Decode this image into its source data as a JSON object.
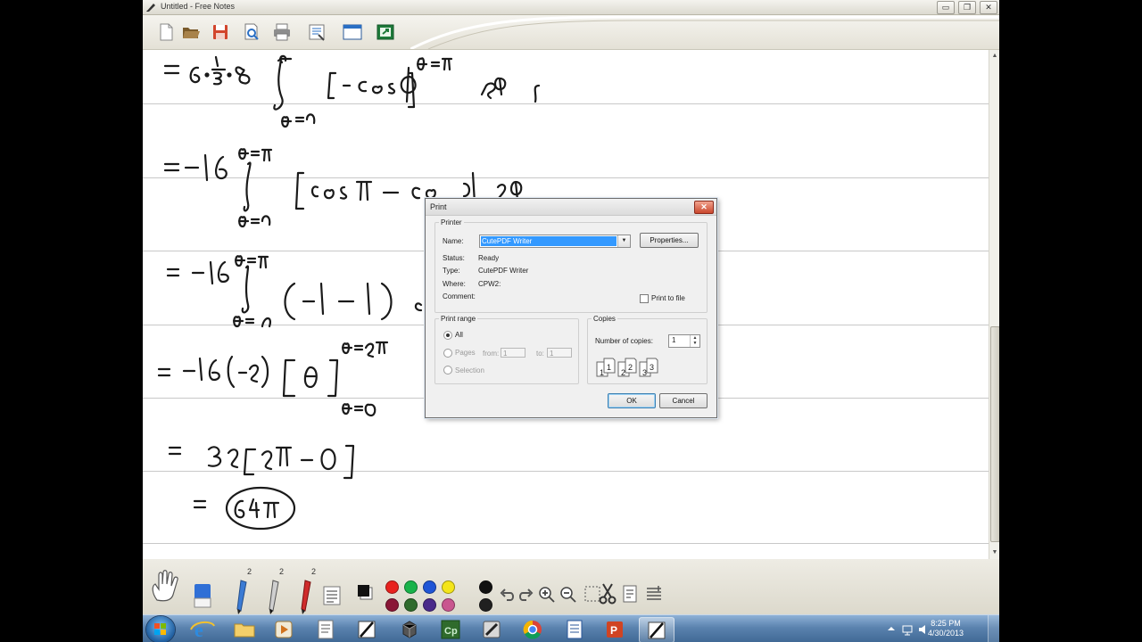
{
  "window": {
    "title": "Untitled - Free Notes",
    "controls": {
      "minimize": "▭",
      "maximize": "❐",
      "close": "✕"
    }
  },
  "toolbar": {
    "icons": [
      "new-page-icon",
      "open-folder-icon",
      "save-icon",
      "print-preview-icon",
      "print-icon",
      "page-setup-icon",
      "fullscreen-icon",
      "export-icon"
    ]
  },
  "notes": {
    "description_lines": [
      "= 6·1/3·8 ∫ [−cos φ] dθ",
      "= −16 ∫ [cos π − cos 0] dθ",
      "= −16 ∫ (−1 − 1) dθ",
      "= −16(−2) [θ]",
      "= 32 [2π − 0]",
      "= 64π"
    ]
  },
  "print_dialog": {
    "title": "Print",
    "printer": {
      "group_label": "Printer",
      "name_label": "Name:",
      "name_value": "CutePDF Writer",
      "properties_button": "Properties...",
      "status_label": "Status:",
      "status_value": "Ready",
      "type_label": "Type:",
      "type_value": "CutePDF Writer",
      "where_label": "Where:",
      "where_value": "CPW2:",
      "comment_label": "Comment:",
      "print_to_file_label": "Print to file",
      "print_to_file_checked": false
    },
    "print_range": {
      "group_label": "Print range",
      "all_label": "All",
      "pages_label": "Pages",
      "from_label": "from:",
      "from_value": "1",
      "to_label": "to:",
      "to_value": "1",
      "selection_label": "Selection",
      "selected": "All"
    },
    "copies": {
      "group_label": "Copies",
      "number_label": "Number of copies:",
      "number_value": "1",
      "collate_pages": [
        "1",
        "1",
        "2",
        "2",
        "3",
        "3"
      ]
    },
    "ok_button": "OK",
    "cancel_button": "Cancel"
  },
  "bottom_tools": {
    "pen_sizes": [
      "2",
      "2",
      "2"
    ],
    "colors": [
      "#e8231f",
      "#19b34a",
      "#1f55d6",
      "#f4e51a",
      "#111111",
      "#8a1736",
      "#2f6b2c",
      "#4a2a8a",
      "#c9568f",
      "#202020"
    ]
  },
  "taskbar": {
    "clock_time": "8:25 PM",
    "clock_date": "4/30/2013",
    "apps": [
      "internet-explorer-icon",
      "file-explorer-icon",
      "media-player-icon",
      "notepad-icon",
      "free-notes-icon",
      "3d-box-icon",
      "captivate-icon",
      "sketch-icon",
      "chrome-icon",
      "word-icon",
      "powerpoint-icon",
      "free-notes-active-icon"
    ]
  }
}
